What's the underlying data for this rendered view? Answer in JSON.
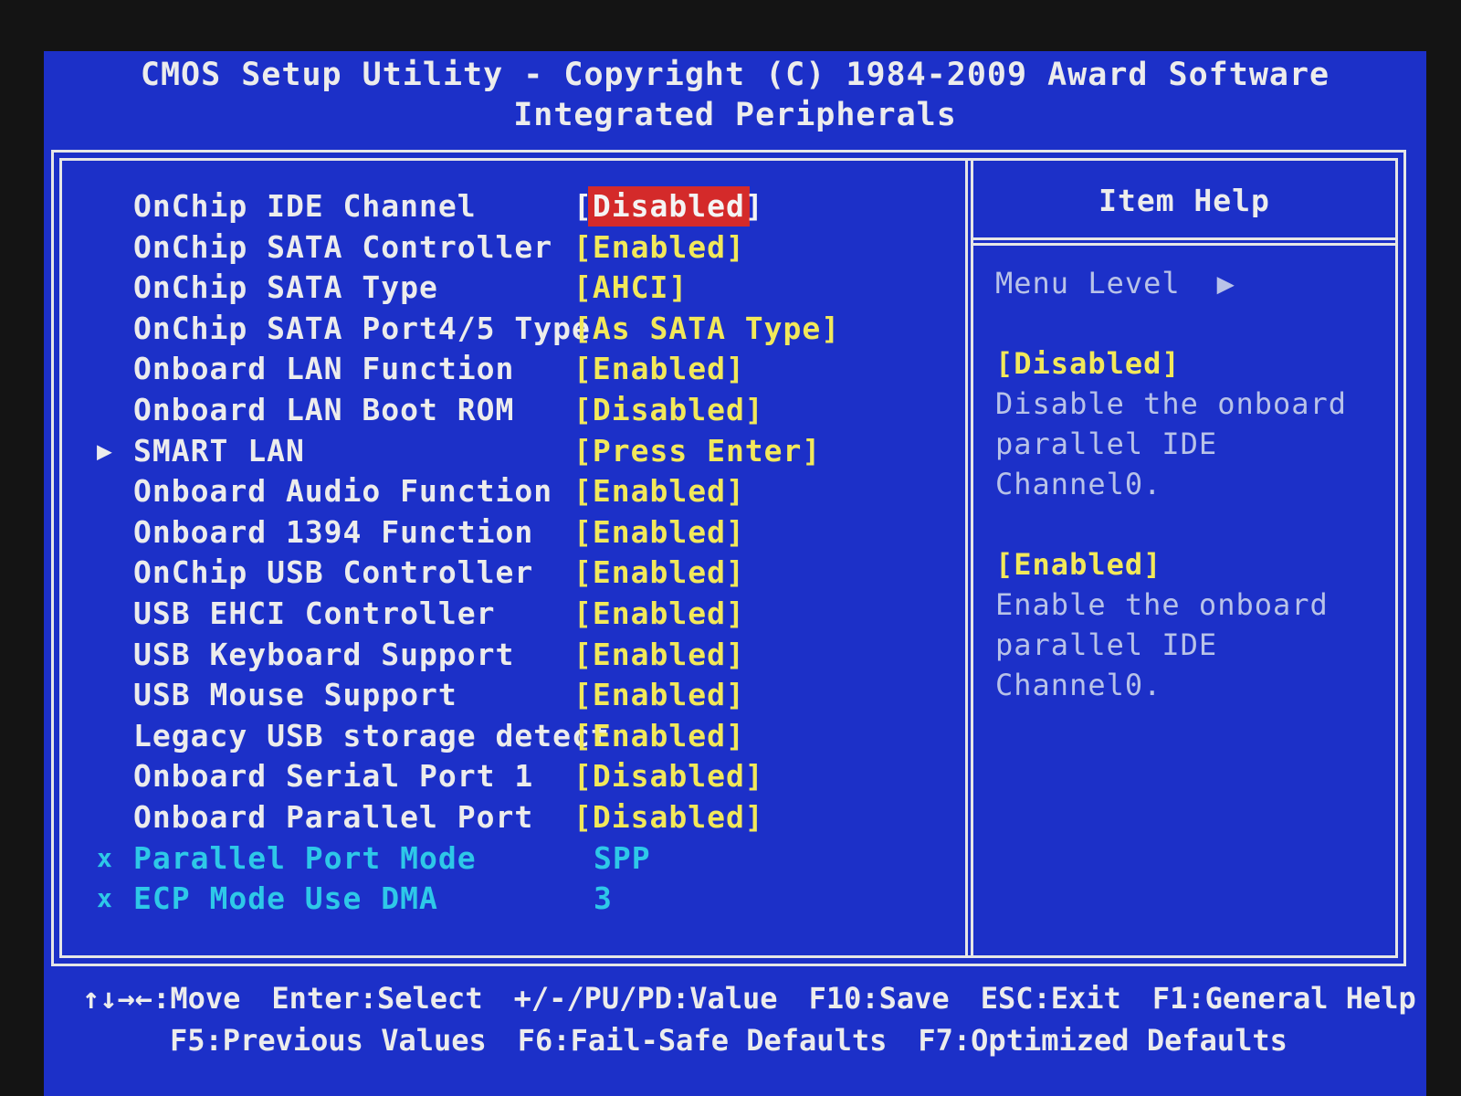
{
  "header": {
    "title": "CMOS Setup Utility - Copyright (C) 1984-2009 Award Software",
    "subtitle": "Integrated Peripherals"
  },
  "settings": [
    {
      "marker": "",
      "label": "OnChip IDE Channel",
      "value": "[Disabled]",
      "selected": true,
      "state": "active"
    },
    {
      "marker": "",
      "label": "OnChip SATA Controller",
      "value": "[Enabled]",
      "state": "active"
    },
    {
      "marker": "",
      "label": "OnChip SATA Type",
      "value": "[AHCI]",
      "state": "active"
    },
    {
      "marker": "",
      "label": "OnChip SATA Port4/5 Type",
      "value": "[As SATA Type]",
      "state": "active"
    },
    {
      "marker": "",
      "label": "Onboard LAN Function",
      "value": "[Enabled]",
      "state": "active"
    },
    {
      "marker": "",
      "label": "Onboard LAN Boot ROM",
      "value": "[Disabled]",
      "state": "active"
    },
    {
      "marker": "▶",
      "label": "SMART LAN",
      "value": "[Press Enter]",
      "state": "submenu"
    },
    {
      "marker": "",
      "label": "Onboard Audio Function",
      "value": "[Enabled]",
      "state": "active"
    },
    {
      "marker": "",
      "label": "Onboard 1394 Function",
      "value": "[Enabled]",
      "state": "active"
    },
    {
      "marker": "",
      "label": "OnChip USB Controller",
      "value": "[Enabled]",
      "state": "active"
    },
    {
      "marker": "",
      "label": "USB EHCI Controller",
      "value": "[Enabled]",
      "state": "active"
    },
    {
      "marker": "",
      "label": "USB Keyboard Support",
      "value": "[Enabled]",
      "state": "active"
    },
    {
      "marker": "",
      "label": "USB Mouse Support",
      "value": "[Enabled]",
      "state": "active"
    },
    {
      "marker": "",
      "label": "Legacy USB storage detect",
      "value": "[Enabled]",
      "state": "active"
    },
    {
      "marker": "",
      "label": "Onboard Serial Port 1",
      "value": "[Disabled]",
      "state": "active"
    },
    {
      "marker": "",
      "label": "Onboard Parallel Port",
      "value": "[Disabled]",
      "state": "active"
    },
    {
      "marker": "x",
      "label": "Parallel Port Mode",
      "value": "SPP",
      "state": "unavailable"
    },
    {
      "marker": "x",
      "label": "ECP Mode Use DMA",
      "value": "3",
      "state": "unavailable"
    }
  ],
  "help": {
    "title": "Item Help",
    "menu_level_label": "Menu Level",
    "menu_level_marker": "▶",
    "option1": "[Disabled]",
    "option1_desc_line1": "Disable the onboard",
    "option1_desc_line2": "parallel IDE Channel0.",
    "option2": "[Enabled]",
    "option2_desc_line1": "Enable the onboard",
    "option2_desc_line2": "parallel IDE Channel0."
  },
  "footer": {
    "line1": [
      "↑↓→←:Move",
      "Enter:Select",
      "+/-/PU/PD:Value",
      "F10:Save",
      "ESC:Exit",
      "F1:General Help"
    ],
    "line2": [
      "F5:Previous Values",
      "F6:Fail-Safe Defaults",
      "F7:Optimized Defaults"
    ]
  },
  "colors": {
    "background": "#1c30c8",
    "text": "#ececec",
    "value": "#f2e85a",
    "unavailable": "#2ec8e8",
    "highlight": "#d42a2a"
  }
}
